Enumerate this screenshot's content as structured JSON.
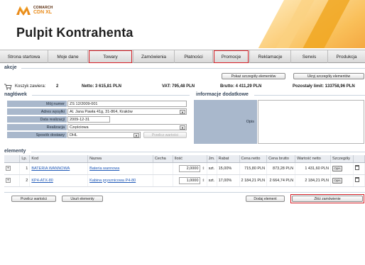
{
  "header": {
    "brand": "COMARCH",
    "product": "CDN XL",
    "title": "Pulpit Kontrahenta"
  },
  "tabs": [
    {
      "label": "Strona startowa",
      "highlighted": false
    },
    {
      "label": "Moje dane",
      "highlighted": false
    },
    {
      "label": "Towary",
      "highlighted": true
    },
    {
      "label": "Zamówienia",
      "highlighted": false
    },
    {
      "label": "Płatności",
      "highlighted": false
    },
    {
      "label": "Promocje",
      "highlighted": true
    },
    {
      "label": "Reklamacje",
      "highlighted": false
    },
    {
      "label": "Serwis",
      "highlighted": false
    },
    {
      "label": "Produkcja",
      "highlighted": false
    }
  ],
  "akcje": {
    "title": "akcje",
    "show_details": "Pokaż szczegóły elementów",
    "hide_details": "Ukryj szczegóły elementów"
  },
  "summary": {
    "cart_label": "Koszyk zawiera:",
    "cart_count": "2",
    "netto": "Netto: 3 615,81 PLN",
    "vat": "VAT: 795,48 PLN",
    "brutto": "Brutto: 4 411,29 PLN",
    "limit": "Pozostały limit: 133758,96 PLN"
  },
  "naglowek": {
    "title": "nagłówek",
    "fields": {
      "moj_numer": {
        "label": "Mój numer",
        "value": "ZS 12/2009-001"
      },
      "adres": {
        "label": "Adres wysyłki",
        "value": "Al. Jana Pawła 41g, 31-864, Kraków"
      },
      "data": {
        "label": "Data realizacji",
        "value": "2009-12-31"
      },
      "realizacja": {
        "label": "Realizacja",
        "value": "Częściowa"
      },
      "sposob": {
        "label": "Sposób dostawy",
        "value": "DHL"
      }
    },
    "recalc_button": "Przelicz wartości"
  },
  "info": {
    "title": "informacje dodatkowe",
    "opis_label": "Opis"
  },
  "elementy": {
    "title": "elementy",
    "columns": [
      "Lp.",
      "Kod",
      "Nazwa",
      "Cecha",
      "Ilość",
      "Jm.",
      "Rabat",
      "Cena netto",
      "Cena brutto",
      "Wartość netto",
      "Szczegóły",
      ""
    ],
    "rows": [
      {
        "lp": "1",
        "kod": "BATERIA WANNOWA",
        "nazwa": "Bateria wannowa",
        "cecha": "",
        "ilosc": "2,0000",
        "jm": "szt.",
        "rabat": "15,00%",
        "cena_netto": "715,80 PLN",
        "cena_brutto": "873,28 PLN",
        "wartosc_netto": "1 431,60 PLN",
        "opis": "Opis"
      },
      {
        "lp": "2",
        "kod": "KP4-ATX-80",
        "nazwa": "Kabina prysznicowa P4-80",
        "cecha": "",
        "ilosc": "1,0000",
        "jm": "szt.",
        "rabat": "17,00%",
        "cena_netto": "2 184,21 PLN",
        "cena_brutto": "2 664,74 PLN",
        "wartosc_netto": "2 184,21 PLN",
        "opis": "Opis"
      }
    ]
  },
  "bottom": {
    "recalc": "Przelicz wartości",
    "remove": "Usuń elementy",
    "add": "Dodaj element",
    "order": "Złóż zamówienie"
  }
}
